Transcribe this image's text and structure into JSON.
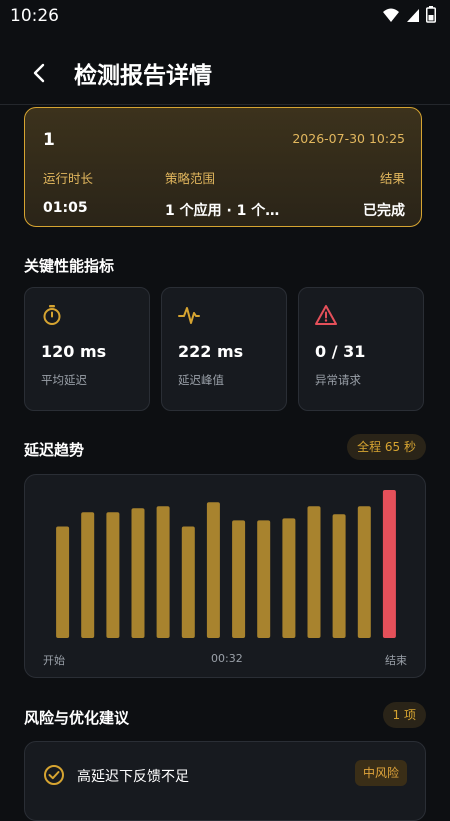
{
  "status_bar": {
    "time": "10:26"
  },
  "header": {
    "title": "检测报告详情"
  },
  "summary": {
    "id": "1",
    "datetime": "2026-07-30 10:25",
    "runtime_label": "运行时长",
    "runtime_value": "01:05",
    "scope_label": "策略范围",
    "scope_value": "1 个应用 · 1 个…",
    "result_label": "结果",
    "result_value": "已完成"
  },
  "metrics_section": {
    "title": "关键性能指标",
    "items": [
      {
        "icon": "stopwatch-icon",
        "value": "120 ms",
        "label": "平均延迟"
      },
      {
        "icon": "pulse-icon",
        "value": "222 ms",
        "label": "延迟峰值"
      },
      {
        "icon": "warning-icon",
        "value": "0 / 31",
        "label": "异常请求"
      }
    ]
  },
  "trend_section": {
    "title": "延迟趋势",
    "pill": "全程 65 秒"
  },
  "chart_data": {
    "type": "bar",
    "values": [
      110,
      124,
      124,
      128,
      130,
      110,
      134,
      116,
      116,
      118,
      130,
      122,
      130,
      146
    ],
    "highlight_index": 13,
    "colors": {
      "normal": "#a8832e",
      "highlight": "#e5505a"
    },
    "x_tick_labels": [
      "开始",
      "00:32",
      "结束"
    ]
  },
  "risk_section": {
    "title": "风险与优化建议",
    "pill": "1 项",
    "items": [
      {
        "icon": "check-circle-icon",
        "title": "高延迟下反馈不足",
        "badge": "中风险"
      }
    ]
  }
}
